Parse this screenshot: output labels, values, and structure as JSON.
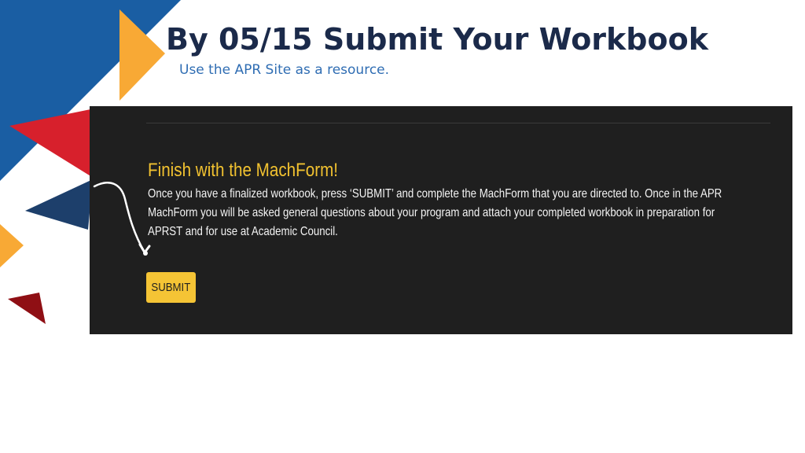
{
  "slide": {
    "title": "By 05/15 Submit Your Workbook",
    "subtitle": "Use the APR Site as a resource."
  },
  "screenshot": {
    "heading": "Finish with the MachForm!",
    "body": "Once you have a finalized workbook, press ‘SUBMIT’ and complete the MachForm that you are directed to. Once in the APR MachForm you will be asked general questions about your program and attach your completed workbook in preparation for APRST and for use at Academic Council.",
    "submit_label": "SUBMIT"
  },
  "colors": {
    "title": "#1b2a4a",
    "subtitle": "#2f6db3",
    "accent_yellow": "#f5c435",
    "panel_bg": "#1f1f1f",
    "decor_blue": "#1a5ea3",
    "decor_navy": "#1d3f6b",
    "decor_orange": "#f8a935",
    "decor_red": "#d7202c",
    "decor_darkred": "#8f0f14"
  },
  "icons": {
    "hand_drawn_arrow": "hand-drawn-arrow-icon"
  }
}
